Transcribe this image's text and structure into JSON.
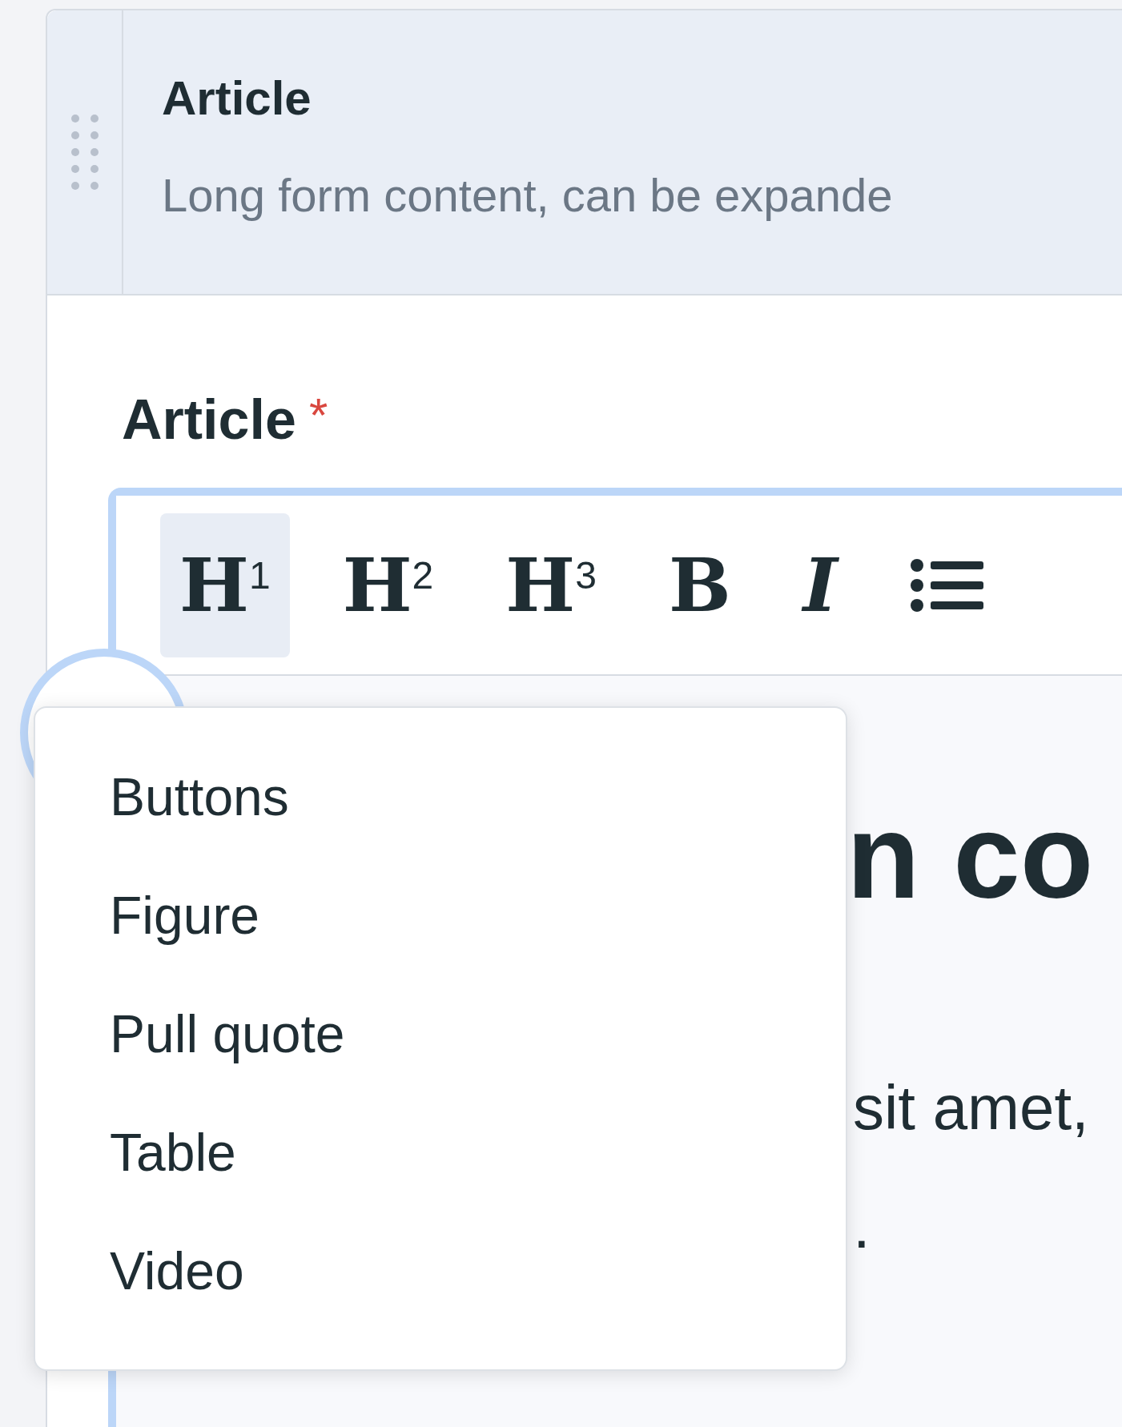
{
  "panel": {
    "title": "Article",
    "description": "Long form content, can be expande"
  },
  "field": {
    "label": "Article",
    "required_mark": "*"
  },
  "toolbar": [
    {
      "kind": "heading",
      "label": "H",
      "suffix": "1",
      "selected": true
    },
    {
      "kind": "heading",
      "label": "H",
      "suffix": "2",
      "selected": false
    },
    {
      "kind": "heading",
      "label": "H",
      "suffix": "3",
      "selected": false
    },
    {
      "kind": "bold",
      "label": "B",
      "selected": false
    },
    {
      "kind": "italic",
      "label": "I",
      "selected": false
    },
    {
      "kind": "bullet-list",
      "selected": false
    }
  ],
  "insert_menu": {
    "items": [
      "Buttons",
      "Figure",
      "Pull quote",
      "Table",
      "Video"
    ]
  },
  "content": {
    "heading": "n co",
    "lines": [
      "sit amet,",
      "."
    ]
  }
}
